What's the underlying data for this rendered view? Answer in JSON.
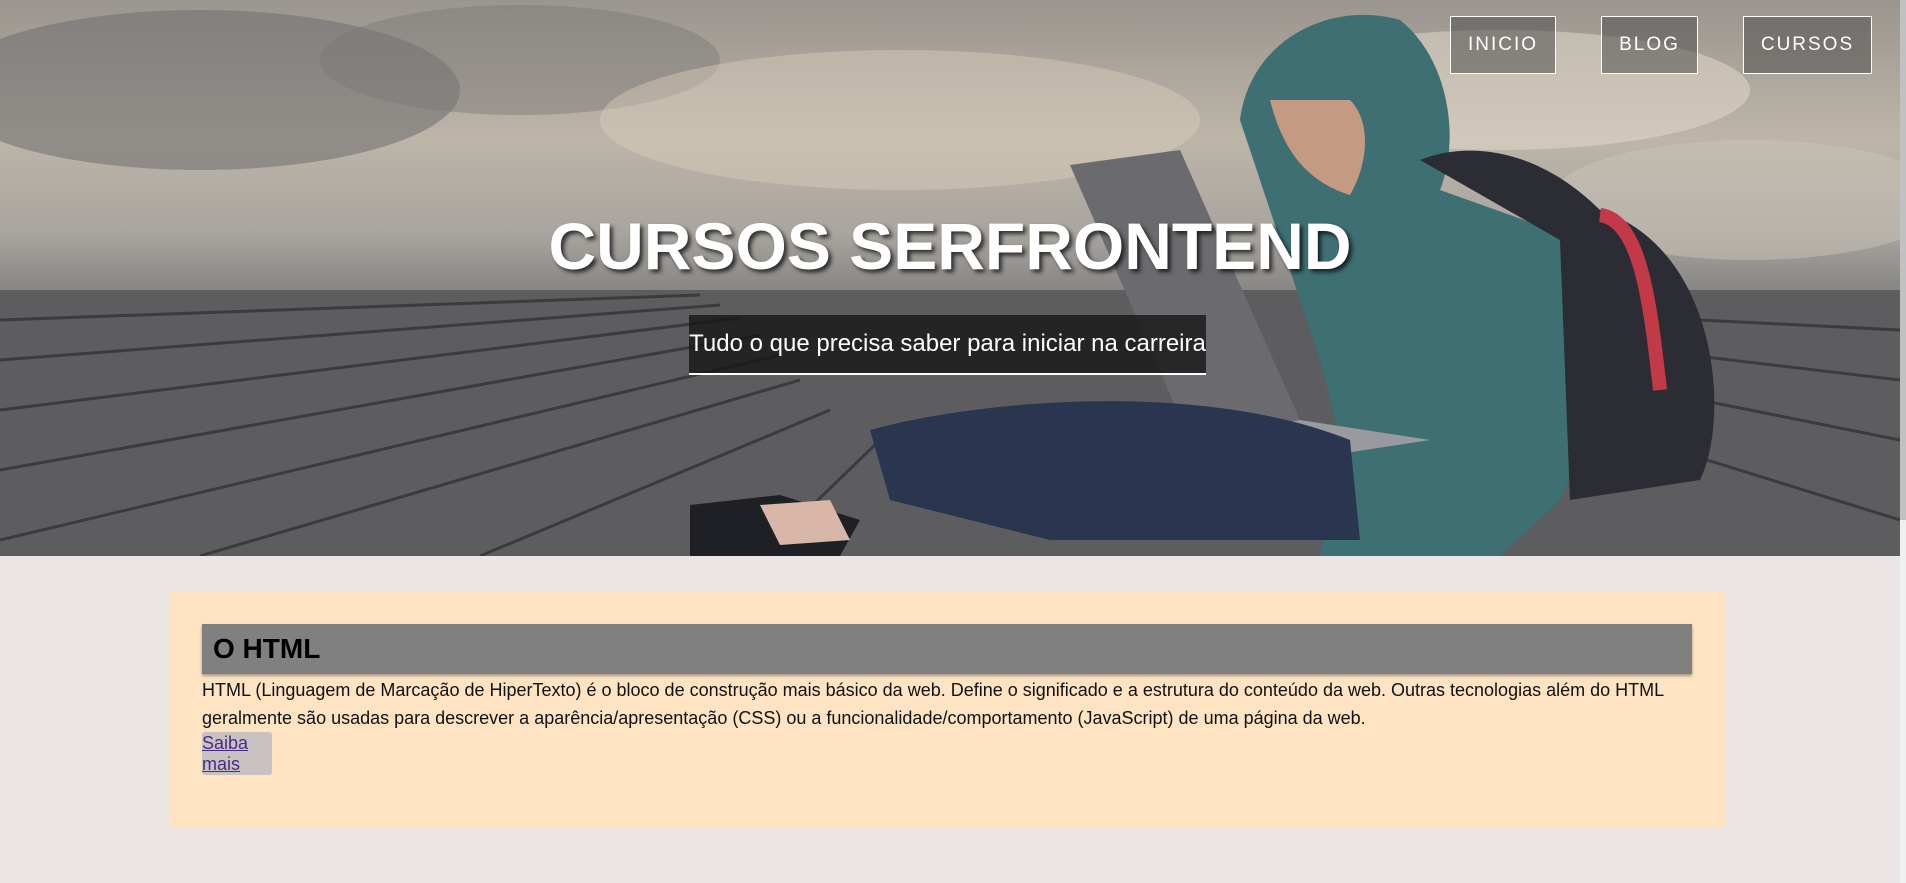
{
  "nav": {
    "items": [
      {
        "label": "INICIO"
      },
      {
        "label": "BLOG"
      },
      {
        "label": "CURSOS"
      }
    ]
  },
  "hero": {
    "title": "CURSOS SERFRONTEND",
    "subtitle": "Tudo o que precisa saber para iniciar na carreira"
  },
  "card": {
    "title": "O HTML",
    "text": "HTML (Linguagem de Marcação de HiperTexto) é o bloco de construção mais básico da web. Define o significado e a estrutura do conteúdo da web. Outras tecnologias além do HTML geralmente são usadas para descrever a aparência/apresentação (CSS) ou a funcionalidade/comportamento (JavaScript) de uma página da web.",
    "button_label": "Saiba mais"
  },
  "colors": {
    "page_bg": "#ebe5e5",
    "card_bg": "#ffe4c4",
    "card_title_bg": "#808080",
    "link": "#4b2a86"
  }
}
